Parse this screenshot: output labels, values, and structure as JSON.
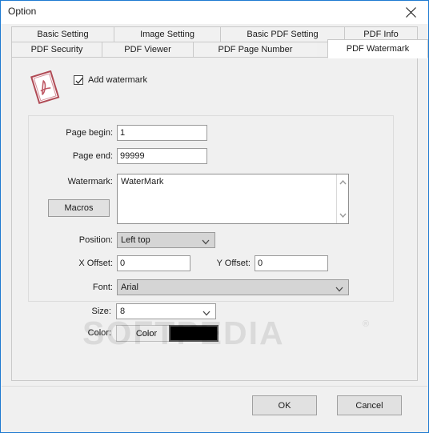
{
  "window": {
    "title": "Option",
    "close_icon": "close-icon",
    "accent_color": "#1e7ad1"
  },
  "tabs": {
    "row1": [
      {
        "label": "Basic Setting",
        "selected": false
      },
      {
        "label": "Image Setting",
        "selected": false
      },
      {
        "label": "Basic PDF Setting",
        "selected": false
      },
      {
        "label": "PDF Info",
        "selected": false
      }
    ],
    "row2": [
      {
        "label": "PDF Security",
        "selected": false
      },
      {
        "label": "PDF Viewer",
        "selected": false
      },
      {
        "label": "PDF Page Number",
        "selected": false
      },
      {
        "label": "PDF Watermark",
        "selected": true
      }
    ]
  },
  "panel": {
    "icon_name": "pdf-document-icon",
    "add_watermark": {
      "label": "Add watermark",
      "checked": true
    },
    "fields": {
      "page_begin": {
        "label": "Page begin:",
        "value": "1"
      },
      "page_end": {
        "label": "Page end:",
        "value": "99999"
      },
      "watermark": {
        "label": "Watermark:",
        "value": "WaterMark"
      },
      "macros": {
        "label": "Macros"
      },
      "position": {
        "label": "Position:",
        "value": "Left top"
      },
      "x_offset": {
        "label": "X Offset:",
        "value": "0"
      },
      "y_offset": {
        "label": "Y Offset:",
        "value": "0"
      },
      "font": {
        "label": "Font:",
        "value": "Arial"
      },
      "size": {
        "label": "Size:",
        "value": "8"
      },
      "color": {
        "label": "Color:",
        "button_label": "Color",
        "swatch_hex": "#000000"
      }
    }
  },
  "footer": {
    "ok_label": "OK",
    "cancel_label": "Cancel"
  },
  "overlay": {
    "watermark_text": "SOFTPEDIA",
    "registered_mark": "®"
  }
}
